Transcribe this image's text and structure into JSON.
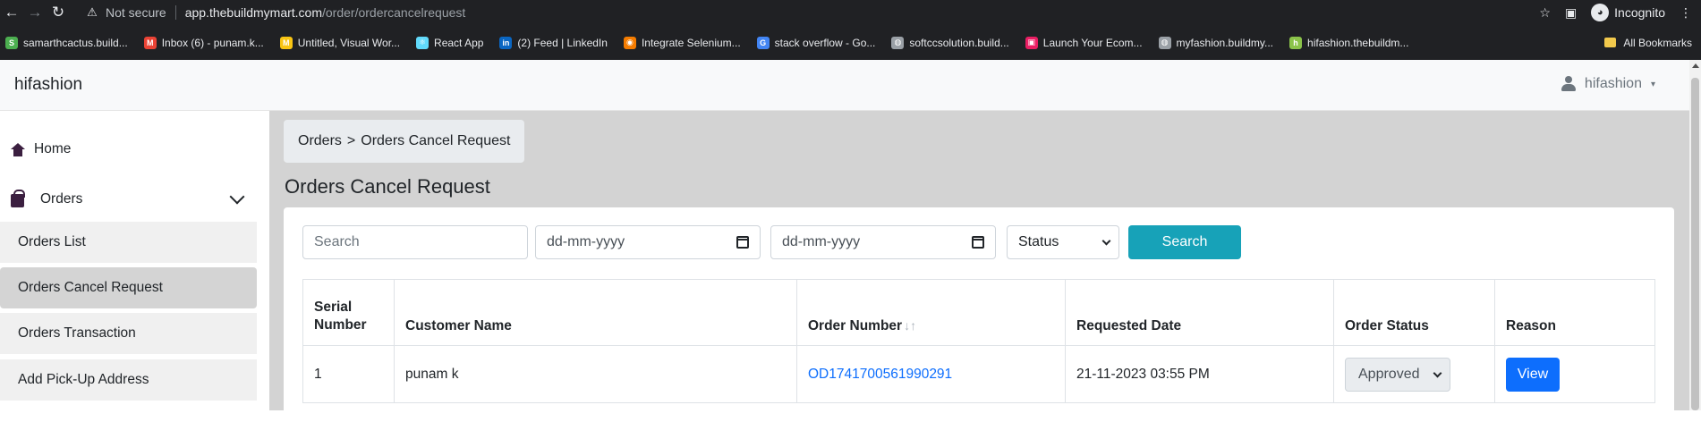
{
  "browser": {
    "security_label": "Not secure",
    "url_host": "app.thebuildmymart.com",
    "url_path": "/order/ordercancelrequest",
    "profile_label": "Incognito",
    "bookmarks": [
      {
        "label": "samarthcactus.build...",
        "color": "#4caf50",
        "glyph": "S"
      },
      {
        "label": "Inbox (6) - punam.k...",
        "color": "#ea4335",
        "glyph": "M"
      },
      {
        "label": "Untitled, Visual Wor...",
        "color": "#f9c513",
        "glyph": "M"
      },
      {
        "label": "React App",
        "color": "#61dafb",
        "glyph": "⚛"
      },
      {
        "label": "(2) Feed | LinkedIn",
        "color": "#0a66c2",
        "glyph": "in"
      },
      {
        "label": "Integrate Selenium...",
        "color": "#f57c00",
        "glyph": "◉"
      },
      {
        "label": "stack overflow - Go...",
        "color": "#4285f4",
        "glyph": "G"
      },
      {
        "label": "softccsolution.build...",
        "color": "#9aa0a6",
        "glyph": "◍"
      },
      {
        "label": "Launch Your Ecom...",
        "color": "#e91e63",
        "glyph": "▣"
      },
      {
        "label": "myfashion.buildmy...",
        "color": "#9aa0a6",
        "glyph": "◍"
      },
      {
        "label": "hifashion.thebuildm...",
        "color": "#8bc34a",
        "glyph": "h"
      }
    ],
    "all_bookmarks_label": "All Bookmarks"
  },
  "nav": {
    "brand": "hifashion",
    "user": "hifashion"
  },
  "sidebar": {
    "home": "Home",
    "orders": "Orders",
    "sub_items": [
      "Orders List",
      "Orders Cancel Request",
      "Orders Transaction",
      "Add Pick-Up Address"
    ],
    "active_index": 1
  },
  "main": {
    "breadcrumb_parent": "Orders",
    "breadcrumb_sep": ">",
    "breadcrumb_current": "Orders Cancel Request",
    "title": "Orders Cancel Request",
    "filters": {
      "search_placeholder": "Search",
      "from_date": "dd-mm-yyyy",
      "to_date": "dd-mm-yyyy",
      "status": "Status",
      "search_button": "Search"
    },
    "table": {
      "headers": [
        "Serial Number",
        "Customer Name",
        "Order Number",
        "Requested Date",
        "Order Status",
        "Reason"
      ],
      "rows": [
        {
          "serial": "1",
          "customer": "punam k",
          "order_number": "OD1741700561990291",
          "requested_date": "21-11-2023 03:55 PM",
          "status": "Approved",
          "reason_button": "View"
        }
      ]
    }
  },
  "colors": {
    "accent": "#17a2b8",
    "primary": "#0d6efd",
    "link": "#0d6efd"
  }
}
